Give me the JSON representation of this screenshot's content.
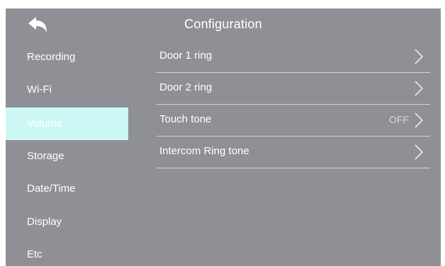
{
  "header": {
    "title": "Configuration",
    "back_icon": "back-arrow-icon"
  },
  "sidebar": {
    "items": [
      {
        "label": "Recording",
        "active": false
      },
      {
        "label": "Wi-Fi",
        "active": false
      },
      {
        "label": "Volume",
        "active": true
      },
      {
        "label": "Storage",
        "active": false
      },
      {
        "label": "Date/Time",
        "active": false
      },
      {
        "label": "Display",
        "active": false
      },
      {
        "label": "Etc",
        "active": false
      }
    ]
  },
  "settings": {
    "rows": [
      {
        "label": "Door 1 ring",
        "value": ""
      },
      {
        "label": "Door 2 ring",
        "value": ""
      },
      {
        "label": "Touch tone",
        "value": "OFF"
      },
      {
        "label": "Intercom Ring tone",
        "value": ""
      }
    ],
    "chevron_icon": "chevron-right-icon"
  },
  "colors": {
    "background": "#8f9096",
    "active_item": "#cdf7f4",
    "text": "#ffffff",
    "divider": "#d4d4d6"
  }
}
